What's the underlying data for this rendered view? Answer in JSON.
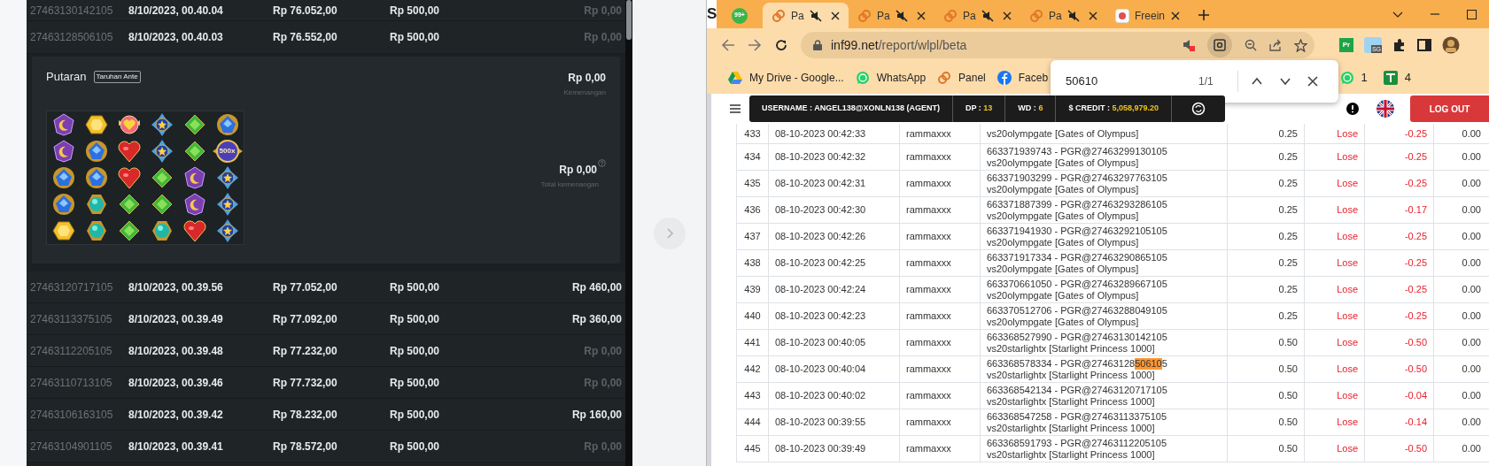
{
  "left_panel": {
    "rows_top": [
      {
        "id": "27463130142105",
        "date": "8/10/2023, 00.40.04",
        "balance": "Rp 76.052,00",
        "bet": "Rp 500,00",
        "win": "Rp 0,00",
        "win_zero": true
      },
      {
        "id": "27463128506105",
        "date": "8/10/2023, 00.40.03",
        "balance": "Rp 76.552,00",
        "bet": "Rp 500,00",
        "win": "Rp 0,00",
        "win_zero": true
      }
    ],
    "detail": {
      "title": "Putaran",
      "badge": "Taruhan Ante",
      "win_amount": "Rp 0,00",
      "win_label": "Kemenangan",
      "multiplier": "500x",
      "total_amount": "Rp 0,00",
      "total_label": "Total kemenangan"
    },
    "rows_bottom": [
      {
        "id": "27463120717105",
        "date": "8/10/2023, 00.39.56",
        "balance": "Rp 77.052,00",
        "bet": "Rp 500,00",
        "win": "Rp 460,00",
        "win_zero": false
      },
      {
        "id": "27463113375105",
        "date": "8/10/2023, 00.39.49",
        "balance": "Rp 77.092,00",
        "bet": "Rp 500,00",
        "win": "Rp 360,00",
        "win_zero": false
      },
      {
        "id": "27463112205105",
        "date": "8/10/2023, 00.39.48",
        "balance": "Rp 77.232,00",
        "bet": "Rp 500,00",
        "win": "Rp 0,00",
        "win_zero": true
      },
      {
        "id": "27463110713105",
        "date": "8/10/2023, 00.39.46",
        "balance": "Rp 77.732,00",
        "bet": "Rp 500,00",
        "win": "Rp 0,00",
        "win_zero": true
      },
      {
        "id": "27463106163105",
        "date": "8/10/2023, 00.39.42",
        "balance": "Rp 78.232,00",
        "bet": "Rp 500,00",
        "win": "Rp 160,00",
        "win_zero": false
      },
      {
        "id": "27463104901105",
        "date": "8/10/2023, 00.39.41",
        "balance": "Rp 78.572,00",
        "bet": "Rp 500,00",
        "win": "Rp 0,00",
        "win_zero": true
      }
    ]
  },
  "browser": {
    "edge_text": "S",
    "tabs": [
      {
        "kind": "pinned",
        "title": "99+",
        "selected": false
      },
      {
        "kind": "link",
        "title": "Pa",
        "muted": true,
        "selected": true
      },
      {
        "kind": "link",
        "title": "Pa",
        "muted": true,
        "selected": false
      },
      {
        "kind": "link",
        "title": "Pa",
        "muted": true,
        "selected": false
      },
      {
        "kind": "link",
        "title": "Pa",
        "muted": true,
        "selected": false
      },
      {
        "kind": "site",
        "title": "Freein",
        "muted": false,
        "selected": false
      }
    ],
    "url_host": "inf99.net",
    "url_path": "/report/wlpl/beta",
    "extensions": [
      {
        "kind": "pr",
        "label": "Pr"
      },
      {
        "kind": "sg",
        "label": "SG"
      }
    ],
    "bookmarks": [
      {
        "kind": "drive",
        "label": "My Drive - Google..."
      },
      {
        "kind": "whatsapp",
        "label": "WhatsApp"
      },
      {
        "kind": "link",
        "label": "Panel"
      },
      {
        "kind": "facebook",
        "label": "Faceb"
      }
    ],
    "bookmarks_right": [
      {
        "kind": "whatsapp",
        "label": "1"
      },
      {
        "kind": "sheet",
        "label": "4"
      }
    ],
    "find": {
      "query": "50610",
      "count": "1/1"
    }
  },
  "page": {
    "header": {
      "username": "USERNAME : ANGEL138@XONLN138 (AGENT)",
      "dp_label": "DP :",
      "dp": "13",
      "wd_label": "WD :",
      "wd": "6",
      "credit_label": "$ CREDIT :",
      "credit": "5,058,979.20",
      "logout": "LOG OUT"
    },
    "rows": [
      {
        "no": "433",
        "date": "08-10-2023 00:42:33",
        "user": "rammaxxx",
        "transaction": [],
        "game": "vs20olympgate [Gates of Olympus]",
        "bet": "0.25",
        "result": "Lose",
        "winloss": "-0.25",
        "balance": "0.00"
      },
      {
        "no": "434",
        "date": "08-10-2023 00:42:32",
        "user": "rammaxxx",
        "transaction": [
          {
            "text": "663371939743 - PGR@27463299130105",
            "highlighted": false
          }
        ],
        "game": "vs20olympgate [Gates of Olympus]",
        "bet": "0.25",
        "result": "Lose",
        "winloss": "-0.25",
        "balance": "0.00"
      },
      {
        "no": "435",
        "date": "08-10-2023 00:42:31",
        "user": "rammaxxx",
        "transaction": [
          {
            "text": "663371903299 - PGR@27463297763105",
            "highlighted": false
          }
        ],
        "game": "vs20olympgate [Gates of Olympus]",
        "bet": "0.25",
        "result": "Lose",
        "winloss": "-0.25",
        "balance": "0.00"
      },
      {
        "no": "436",
        "date": "08-10-2023 00:42:30",
        "user": "rammaxxx",
        "transaction": [
          {
            "text": "663371887399 - PGR@27463293286105",
            "highlighted": false
          }
        ],
        "game": "vs20olympgate [Gates of Olympus]",
        "bet": "0.25",
        "result": "Lose",
        "winloss": "-0.17",
        "balance": "0.00"
      },
      {
        "no": "437",
        "date": "08-10-2023 00:42:26",
        "user": "rammaxxx",
        "transaction": [
          {
            "text": "663371941930 - PGR@27463292105105",
            "highlighted": false
          }
        ],
        "game": "vs20olympgate [Gates of Olympus]",
        "bet": "0.25",
        "result": "Lose",
        "winloss": "-0.25",
        "balance": "0.00"
      },
      {
        "no": "438",
        "date": "08-10-2023 00:42:25",
        "user": "rammaxxx",
        "transaction": [
          {
            "text": "663371917334 - PGR@27463290865105",
            "highlighted": false
          }
        ],
        "game": "vs20olympgate [Gates of Olympus]",
        "bet": "0.25",
        "result": "Lose",
        "winloss": "-0.25",
        "balance": "0.00"
      },
      {
        "no": "439",
        "date": "08-10-2023 00:42:24",
        "user": "rammaxxx",
        "transaction": [
          {
            "text": "663370661050 - PGR@27463289667105",
            "highlighted": false
          }
        ],
        "game": "vs20olympgate [Gates of Olympus]",
        "bet": "0.25",
        "result": "Lose",
        "winloss": "-0.25",
        "balance": "0.00"
      },
      {
        "no": "440",
        "date": "08-10-2023 00:42:23",
        "user": "rammaxxx",
        "transaction": [
          {
            "text": "663370512706 - PGR@27463288049105",
            "highlighted": false
          }
        ],
        "game": "vs20olympgate [Gates of Olympus]",
        "bet": "0.25",
        "result": "Lose",
        "winloss": "-0.25",
        "balance": "0.00"
      },
      {
        "no": "441",
        "date": "08-10-2023 00:40:05",
        "user": "rammaxxx",
        "transaction": [
          {
            "text": "663368527990 - PGR@27463130142105",
            "highlighted": false
          }
        ],
        "game": "vs20starlightx [Starlight Princess 1000]",
        "bet": "0.50",
        "result": "Lose",
        "winloss": "-0.50",
        "balance": "0.00"
      },
      {
        "no": "442",
        "date": "08-10-2023 00:40:04",
        "user": "rammaxxx",
        "transaction": [
          {
            "text": "663368578334 - PGR@27463128",
            "highlighted": false
          },
          {
            "text": "50610",
            "highlighted": true
          },
          {
            "text": "5",
            "highlighted": false
          }
        ],
        "game": "vs20starlightx [Starlight Princess 1000]",
        "bet": "0.50",
        "result": "Lose",
        "winloss": "-0.50",
        "balance": "0.00"
      },
      {
        "no": "443",
        "date": "08-10-2023 00:40:02",
        "user": "rammaxxx",
        "transaction": [
          {
            "text": "663368542134 - PGR@27463120717105",
            "highlighted": false
          }
        ],
        "game": "vs20starlightx [Starlight Princess 1000]",
        "bet": "0.50",
        "result": "Lose",
        "winloss": "-0.04",
        "balance": "0.00"
      },
      {
        "no": "444",
        "date": "08-10-2023 00:39:55",
        "user": "rammaxxx",
        "transaction": [
          {
            "text": "663368547258 - PGR@27463113375105",
            "highlighted": false
          }
        ],
        "game": "vs20starlightx [Starlight Princess 1000]",
        "bet": "0.50",
        "result": "Lose",
        "winloss": "-0.14",
        "balance": "0.00"
      },
      {
        "no": "445",
        "date": "08-10-2023 00:39:49",
        "user": "rammaxxx",
        "transaction": [
          {
            "text": "663368591793 - PGR@27463112205105",
            "highlighted": false
          }
        ],
        "game": "vs20starlightx [Starlight Princess 1000]",
        "bet": "0.50",
        "result": "Lose",
        "winloss": "-0.50",
        "balance": "0.00"
      }
    ]
  }
}
